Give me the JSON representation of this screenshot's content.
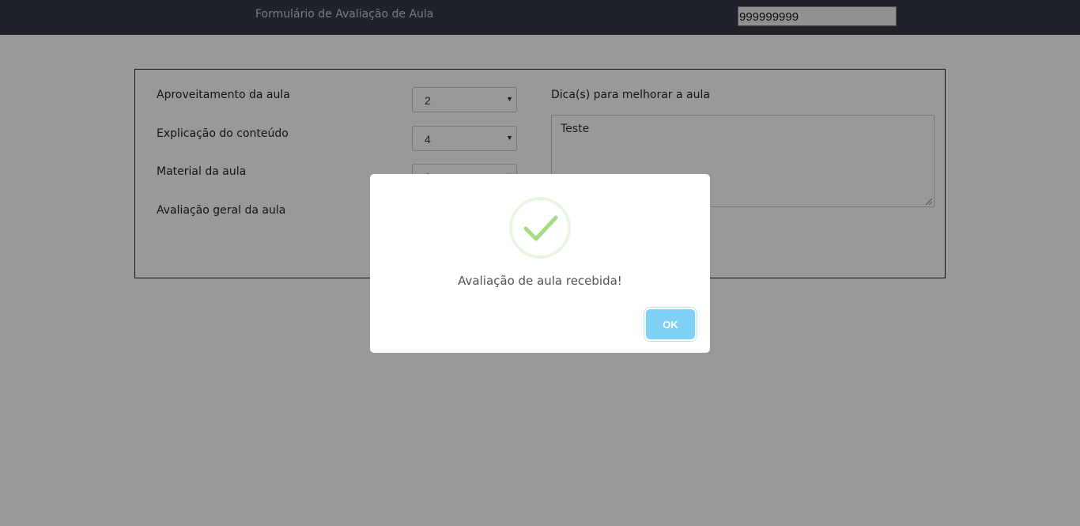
{
  "header": {
    "title": "Formulário de Avaliação de Aula",
    "id_value": "999999999"
  },
  "form": {
    "rows": [
      {
        "label": "Aproveitamento da aula",
        "value": "2"
      },
      {
        "label": "Explicação do conteúdo",
        "value": "4"
      },
      {
        "label": "Material da aula",
        "value": "3"
      },
      {
        "label": "Avaliação geral da aula",
        "value": ""
      }
    ],
    "tips_label": "Dica(s) para melhorar a aula",
    "tips_value": "Teste"
  },
  "modal": {
    "icon": "success-check-icon",
    "message": "Avaliação de aula recebida!",
    "ok_label": "OK"
  },
  "colors": {
    "topbar": "#353a44",
    "success": "#a5dc86",
    "ok_button": "#7fd0f5"
  }
}
